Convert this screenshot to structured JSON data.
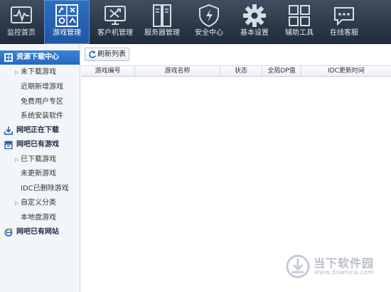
{
  "toolbar": {
    "items": [
      {
        "label": "监控首页",
        "icon": "monitor-pulse-icon"
      },
      {
        "label": "游戏管理",
        "icon": "game-manage-icon",
        "active": true
      },
      {
        "label": "客户机管理",
        "icon": "client-tools-icon"
      },
      {
        "label": "服务器管理",
        "icon": "server-icon"
      },
      {
        "label": "安全中心",
        "icon": "shield-icon"
      },
      {
        "label": "基本设置",
        "icon": "gear-icon"
      },
      {
        "label": "辅助工具",
        "icon": "grid-icon"
      },
      {
        "label": "在线客服",
        "icon": "chat-icon"
      }
    ]
  },
  "sidebar": {
    "sections": [
      {
        "label": "资源下载中心",
        "icon": "resource-download-icon",
        "active": true
      },
      {
        "label": "未下载游戏",
        "expandable": true
      },
      {
        "label": "近期新增游戏"
      },
      {
        "label": "免费用户专区"
      },
      {
        "label": "系统安装软件"
      },
      {
        "label": "网吧正在下载",
        "icon": "downloading-icon"
      },
      {
        "label": "网吧已有游戏",
        "icon": "installed-games-icon"
      },
      {
        "label": "已下载游戏",
        "expandable": true
      },
      {
        "label": "未更新游戏"
      },
      {
        "label": "IDC已删除游戏"
      },
      {
        "label": "自定义分类",
        "expandable": true
      },
      {
        "label": "本地盘游戏"
      },
      {
        "label": "网吧已有网站",
        "icon": "ie-browser-icon"
      }
    ]
  },
  "main": {
    "refresh_label": "刷新列表",
    "columns": [
      "游戏编号",
      "游戏名称",
      "状态",
      "全局DP值",
      "IDC更新时间"
    ]
  },
  "watermark": {
    "title": "当下软件园",
    "url": "www.downxia.com"
  },
  "colors": {
    "toolbar_bg": "#2c3847",
    "active_blue": "#2569c3",
    "sidebar_bg": "#f3f6f9"
  }
}
